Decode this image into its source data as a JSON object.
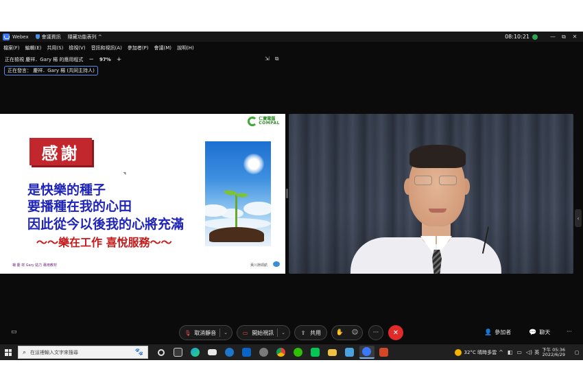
{
  "titlebar": {
    "app_name": "Webex",
    "meeting_info": "會議資訊",
    "hide_menu": "隱藏功能表列 ^",
    "clock": "08:10:21",
    "min": "—",
    "restore": "⧉",
    "close": "✕"
  },
  "menu": [
    "檔案(F)",
    "編輯(E)",
    "共用(S)",
    "檢視(V)",
    "音訊和視訊(A)",
    "參加者(P)",
    "會議(M)",
    "說明(H)"
  ],
  "viewing": {
    "label": "正在檢視 慶祥．Gary 楊 的應用程式",
    "zoom_out": "−",
    "zoom": "97%",
    "zoom_in": "+",
    "speaker": "正在發言： 慶祥．Gary 楊 (共同主持人)"
  },
  "slide": {
    "brand_cn": "仁寶電腦",
    "brand_en": "COMPAL",
    "thanks": "感謝",
    "line1": "是快樂的種子",
    "line2": "要播種在我的心田",
    "line3": "因此從今以後我的心將充滿",
    "line4": "～～樂在工作 喜悅服務～～",
    "footer_left": "楊 慶 祥 Gary 姑力 專用教材",
    "footer_right": "黃川淵領航"
  },
  "controls": {
    "mute": "取消靜音",
    "video": "開始視訊",
    "share": "共用",
    "participants": "參加者",
    "chat": "聊天",
    "more": "···"
  },
  "taskbar": {
    "search_placeholder": "在這裡輸入文字來搜尋",
    "weather": "32°C  晴時多雲",
    "lang": "英",
    "time": "下午 05:36",
    "date": "2022/6/29"
  },
  "colors": {
    "slide_blue_text": "#1f24b8",
    "slide_red_text": "#c41a1a",
    "thanks_bg": "#c1272d",
    "end_call": "#e02b2b",
    "accent_blue": "#5a8dee"
  },
  "icons": [
    "webex-logo-icon",
    "shield-icon",
    "status-dot-icon",
    "mic-off-icon",
    "video-off-icon",
    "share-icon",
    "raise-hand-icon",
    "reaction-icon",
    "end-call-icon",
    "people-icon",
    "chat-icon",
    "windows-start-icon",
    "search-icon",
    "weather-icon"
  ]
}
